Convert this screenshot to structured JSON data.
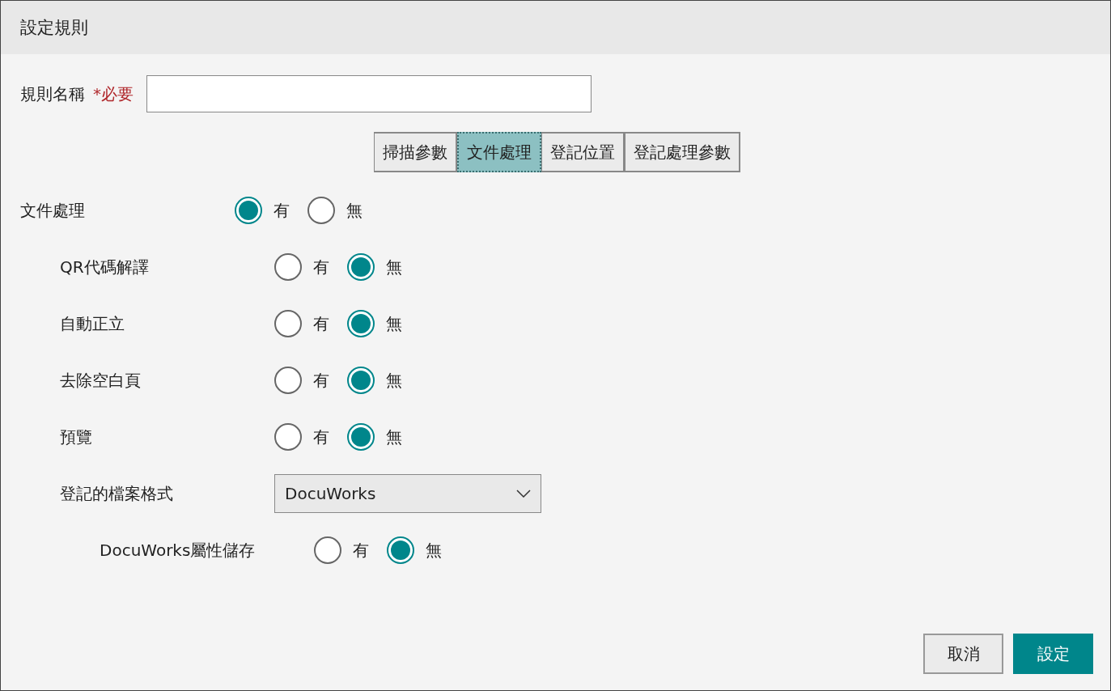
{
  "dialog": {
    "title": "設定規則"
  },
  "rule_name": {
    "label": "規則名稱",
    "required": "*必要"
  },
  "tabs": [
    {
      "label": "掃描參數",
      "selected": false
    },
    {
      "label": "文件處理",
      "selected": true
    },
    {
      "label": "登記位置",
      "selected": false
    },
    {
      "label": "登記處理參數",
      "selected": false
    }
  ],
  "settings": [
    {
      "kind": "radio",
      "label": "文件處理",
      "options": [
        {
          "label": "有",
          "selected": true
        },
        {
          "label": "無",
          "selected": false
        }
      ],
      "children": [
        {
          "kind": "radio",
          "label": "QR代碼解譯",
          "options": [
            {
              "label": "有",
              "selected": false
            },
            {
              "label": "無",
              "selected": true
            }
          ]
        },
        {
          "kind": "radio",
          "label": "自動正立",
          "options": [
            {
              "label": "有",
              "selected": false
            },
            {
              "label": "無",
              "selected": true
            }
          ]
        },
        {
          "kind": "radio",
          "label": "去除空白頁",
          "options": [
            {
              "label": "有",
              "selected": false
            },
            {
              "label": "無",
              "selected": true
            }
          ]
        },
        {
          "kind": "radio",
          "label": "預覽",
          "options": [
            {
              "label": "有",
              "selected": false
            },
            {
              "label": "無",
              "selected": true
            }
          ]
        },
        {
          "kind": "select",
          "label": "登記的檔案格式",
          "value": "DocuWorks",
          "children": [
            {
              "kind": "radio",
              "label": "DocuWorks屬性儲存",
              "options": [
                {
                  "label": "有",
                  "selected": false
                },
                {
                  "label": "無",
                  "selected": true
                }
              ]
            }
          ]
        }
      ]
    }
  ],
  "buttons": [
    {
      "label": "取消",
      "kind": "secondary"
    },
    {
      "label": "設定",
      "kind": "primary"
    }
  ]
}
